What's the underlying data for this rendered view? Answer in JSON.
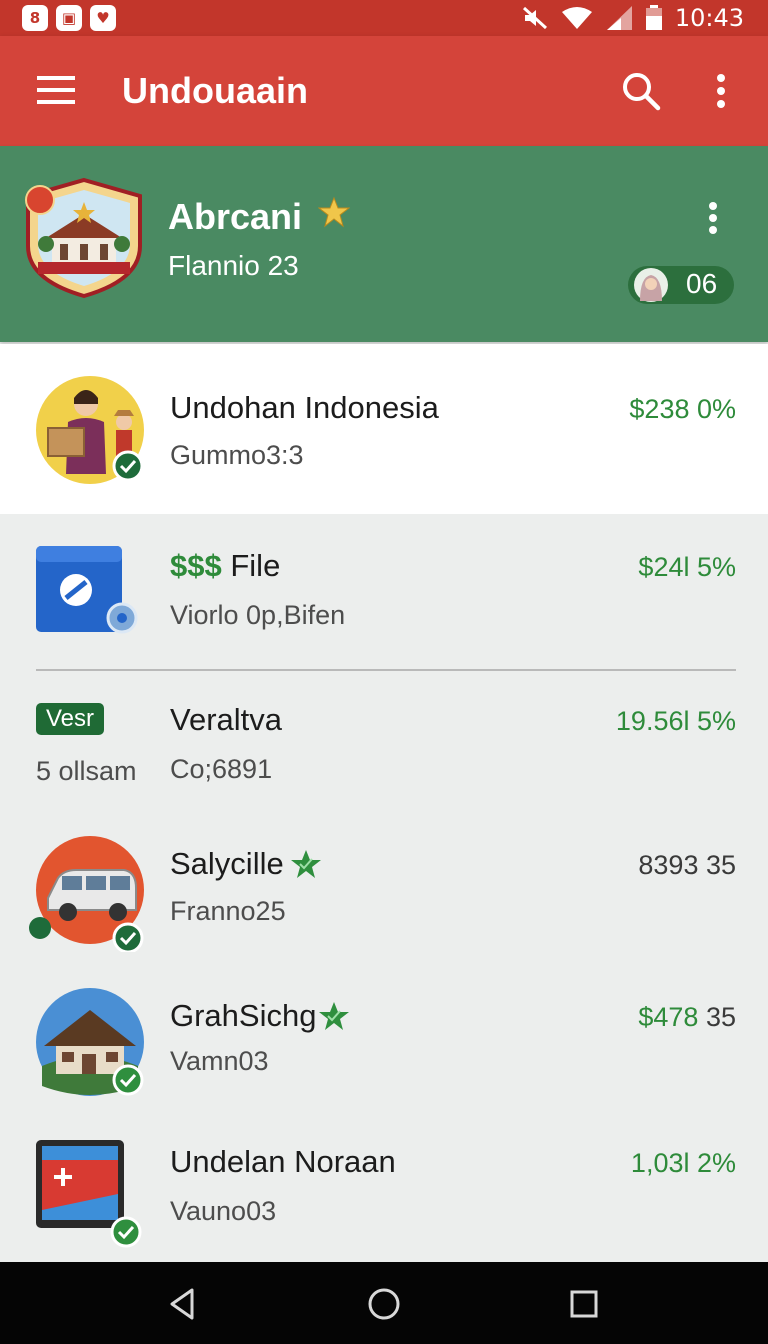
{
  "status_bar": {
    "time": "10:43",
    "notifications": [
      "8",
      "▣",
      "♥"
    ]
  },
  "app_bar": {
    "title": "Undouaain",
    "color": "#d4443a"
  },
  "profile": {
    "name": "Abrcani",
    "subtitle": "Flannio 23",
    "badge_count": "06",
    "color": "#4a8a62"
  },
  "items": [
    {
      "title": "Undohan Indonesia",
      "subtitle": "Gummo3:3",
      "value": "$238 0%"
    },
    {
      "title_prefix": "$$$",
      "title": "File",
      "subtitle": "Viorlo 0p,Bifen",
      "value": "$24l 5%"
    },
    {
      "tag": "Vesr",
      "meta": "5 ollsam",
      "title": "Veraltva",
      "subtitle": "Co;6891",
      "value": "19.56l 5%"
    },
    {
      "title": "Salycille",
      "subtitle": "Franno25",
      "value": "8393 35"
    },
    {
      "title": "GrahSichg",
      "subtitle": "Vamn03",
      "value_highlight": "$478",
      "value_rest": " 35"
    },
    {
      "title": "Undelan Noraan",
      "subtitle": "Vauno03",
      "value": "1,03l 2%"
    }
  ],
  "colors": {
    "accent_green": "#2e8b3a",
    "check_green": "#2f8f3e",
    "status_red": "#c2362b"
  }
}
